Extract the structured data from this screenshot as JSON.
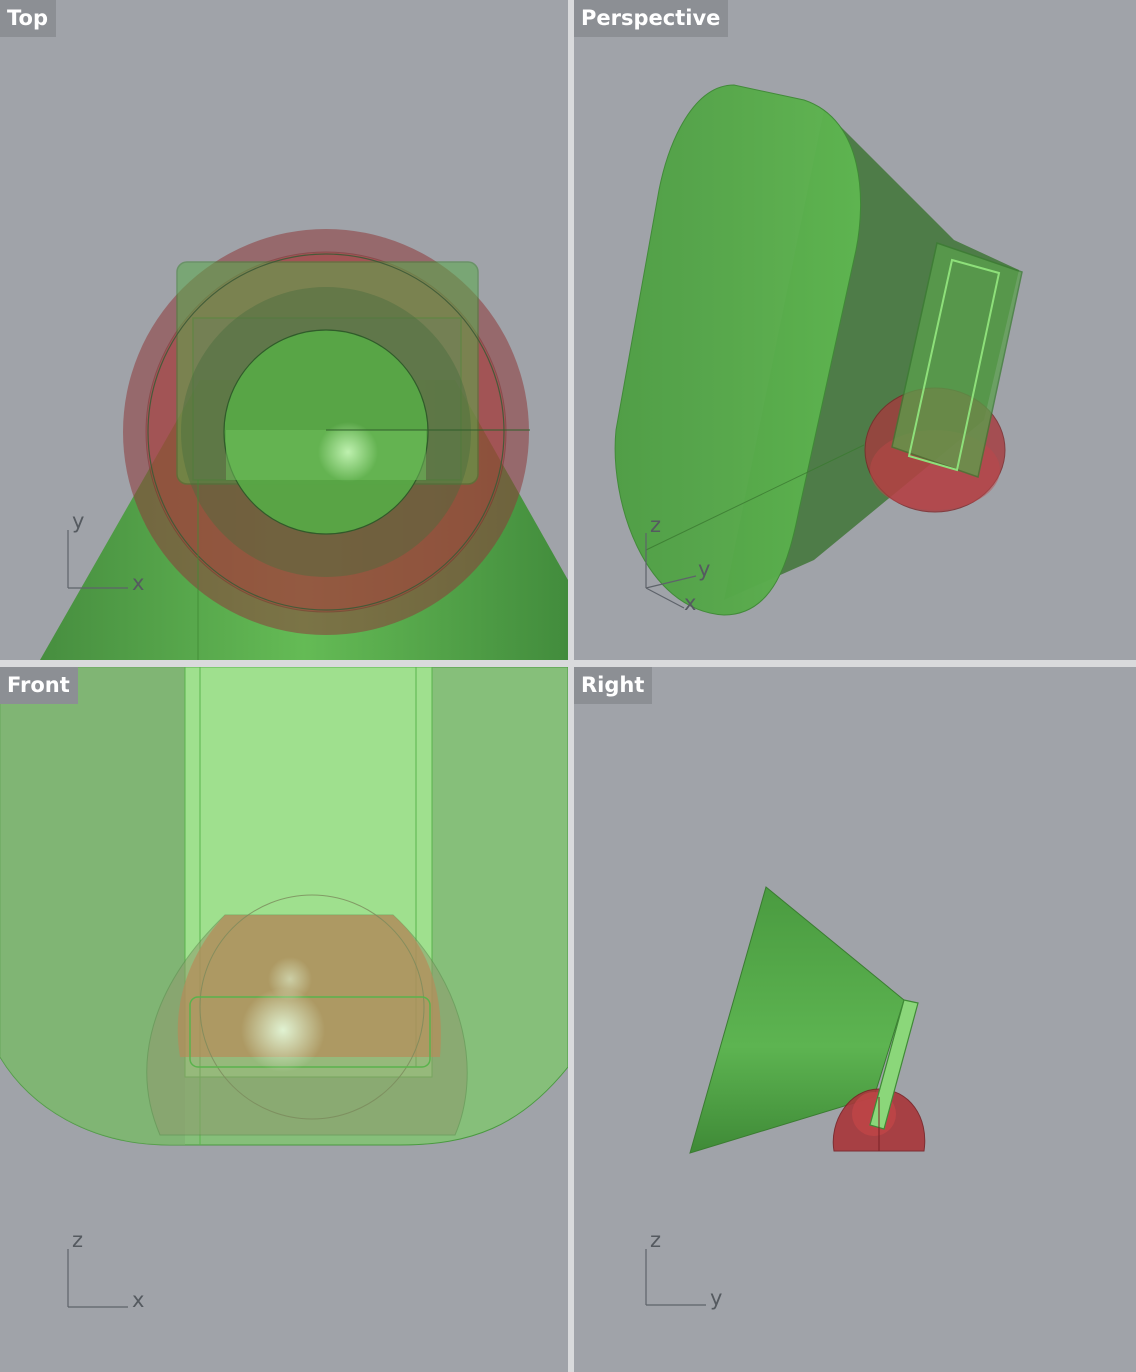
{
  "viewports": {
    "top": {
      "title": "Top",
      "axes": {
        "vertical": "y",
        "horizontal": "x"
      }
    },
    "perspective": {
      "title": "Perspective",
      "axes": {
        "z": "z",
        "y": "y",
        "x": "x"
      }
    },
    "front": {
      "title": "Front",
      "axes": {
        "vertical": "z",
        "horizontal": "x"
      }
    },
    "right": {
      "title": "Right",
      "axes": {
        "vertical": "z",
        "horizontal": "y"
      }
    }
  },
  "colors": {
    "background": "#a0a3a9",
    "divider": "#d9dadc",
    "title_bg": "#8c8f94",
    "green_object": "#4fa143",
    "red_object": "#a8333a",
    "light_green": "#9be18c"
  }
}
